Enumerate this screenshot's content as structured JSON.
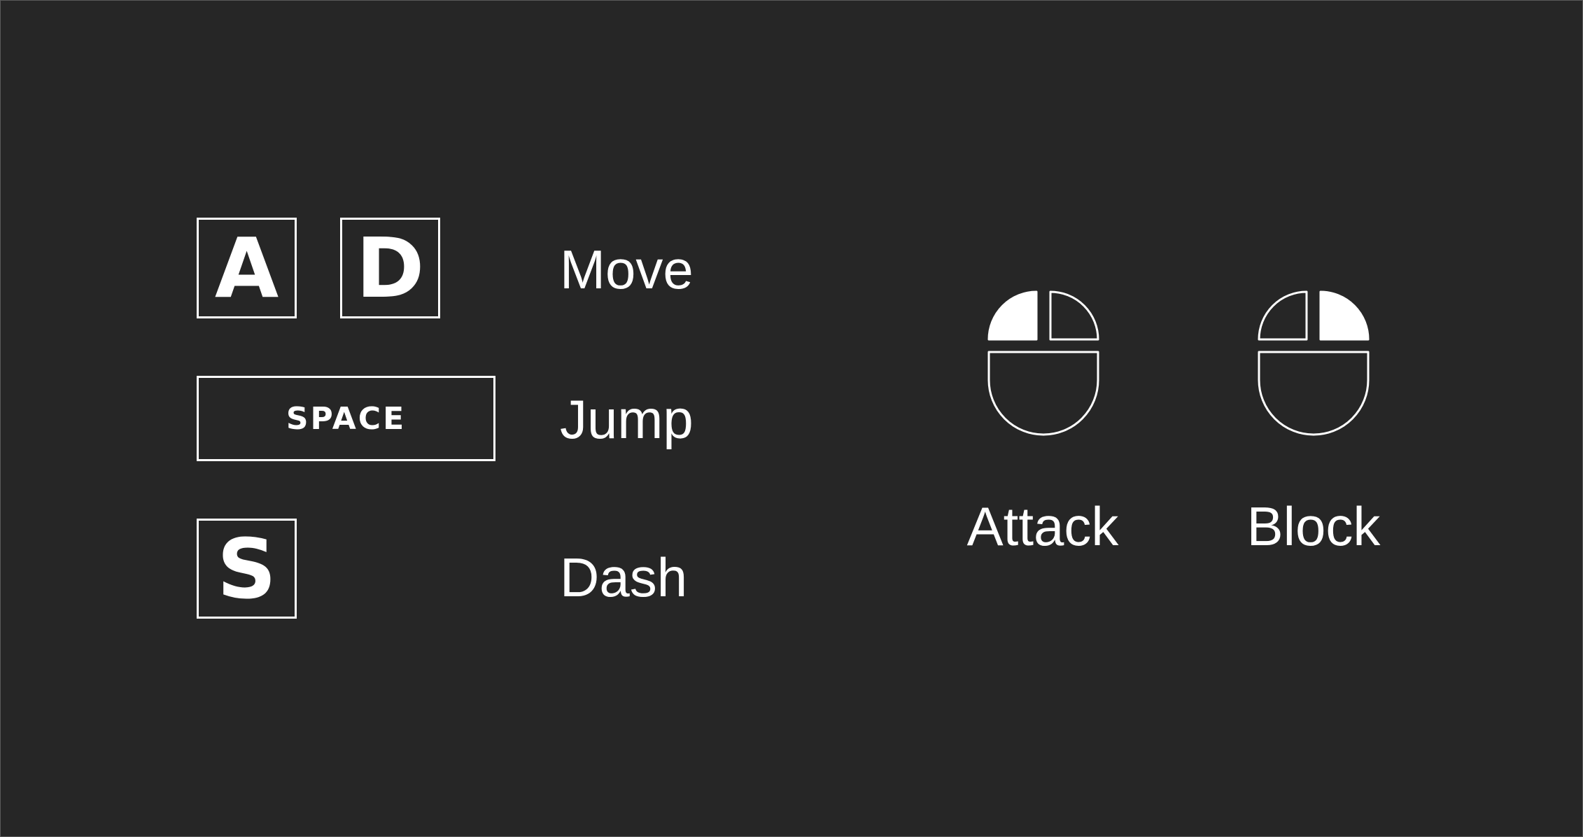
{
  "keyboard": {
    "move": {
      "keys": [
        "A",
        "D"
      ],
      "action": "Move"
    },
    "jump": {
      "key": "SPACE",
      "action": "Jump"
    },
    "dash": {
      "key": "S",
      "action": "Dash"
    }
  },
  "mouse": {
    "attack": {
      "button": "left",
      "action": "Attack"
    },
    "block": {
      "button": "right",
      "action": "Block"
    }
  },
  "colors": {
    "background": "#262626",
    "foreground": "#ffffff"
  }
}
